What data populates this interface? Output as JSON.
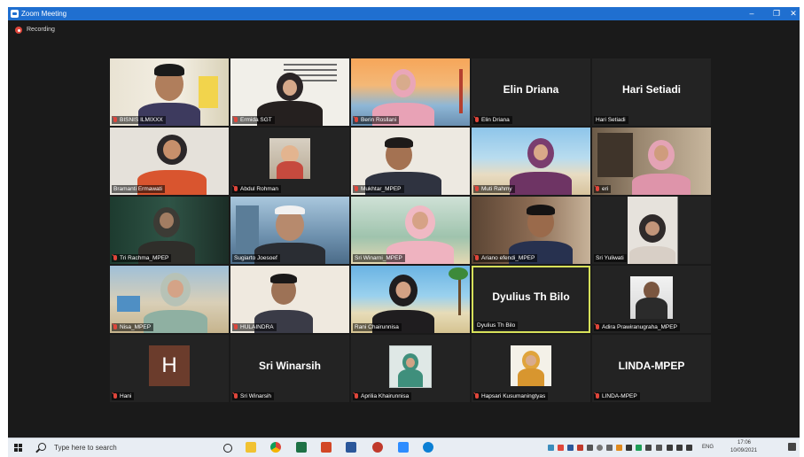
{
  "window": {
    "title": "Zoom Meeting",
    "controls": {
      "minimize": "–",
      "restore": "❐",
      "close": "✕"
    }
  },
  "recording": {
    "label": "Recording",
    "color": "#e0463b"
  },
  "participants": [
    {
      "name": "BISNIS ILMIXXX",
      "muted": true,
      "type": "video"
    },
    {
      "name": "Ermida SGT",
      "muted": true,
      "type": "video"
    },
    {
      "name": "Berin Rosllani",
      "muted": true,
      "type": "video"
    },
    {
      "name": "Elin Driana",
      "display": "Elin Driana",
      "muted": true,
      "type": "name"
    },
    {
      "name": "Hari Setiadi",
      "display": "Hari Setiadi",
      "muted": false,
      "type": "name"
    },
    {
      "name": "Bramanti Ermawati",
      "muted": false,
      "type": "video"
    },
    {
      "name": "Abdul Rohman",
      "muted": true,
      "type": "photo"
    },
    {
      "name": "Mukhtar_MPEP",
      "muted": true,
      "type": "video"
    },
    {
      "name": "Muti Rahmy",
      "muted": true,
      "type": "video"
    },
    {
      "name": "eri",
      "muted": true,
      "type": "video"
    },
    {
      "name": "Tri Rachma_MPEP",
      "muted": true,
      "type": "video"
    },
    {
      "name": "Sugiarto Joesoef",
      "muted": false,
      "type": "video"
    },
    {
      "name": "Sri Winarni_MPEP",
      "muted": false,
      "type": "video"
    },
    {
      "name": "Ariano efendi_MPEP",
      "muted": true,
      "type": "video"
    },
    {
      "name": "Sri Yuliwati",
      "muted": false,
      "type": "video"
    },
    {
      "name": "Nisa_MPEP",
      "muted": true,
      "type": "video"
    },
    {
      "name": "HULAINDRA",
      "muted": true,
      "type": "video"
    },
    {
      "name": "Rani Chairunnisa",
      "muted": false,
      "type": "video"
    },
    {
      "name": "Dyulius Th Bilo",
      "display": "Dyulius Th Bilo",
      "muted": false,
      "type": "name",
      "active": true
    },
    {
      "name": "Adira Prawiranugraha_MPEP",
      "muted": true,
      "type": "photo"
    },
    {
      "name": "Hani",
      "avatar_letter": "H",
      "muted": true,
      "type": "avatar"
    },
    {
      "name": "Sri Winarsih",
      "display": "Sri Winarsih",
      "muted": true,
      "type": "name"
    },
    {
      "name": "Aprilia Khairunnisa",
      "muted": true,
      "type": "photo"
    },
    {
      "name": "Hapsari Kusumaningtyas",
      "muted": true,
      "type": "photo"
    },
    {
      "name": "LINDA-MPEP",
      "display": "LINDA-MPEP",
      "muted": true,
      "type": "name"
    }
  ],
  "taskbar": {
    "search_placeholder": "Type here to search",
    "lang": "ENG",
    "time": "17:06",
    "date": "10/09/2021"
  },
  "colors": {
    "titlebar": "#1f6fd0",
    "background": "#1a1a1a",
    "active_speaker": "#d7e15a",
    "taskbar": "#e8edf3"
  }
}
